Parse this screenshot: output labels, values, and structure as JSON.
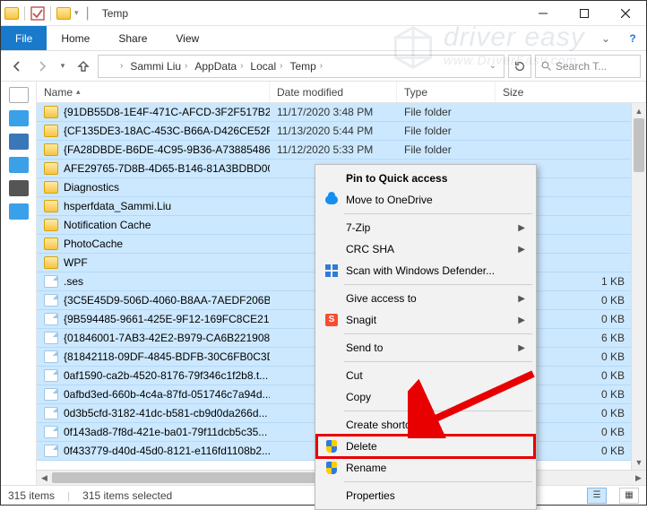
{
  "window": {
    "title": "Temp"
  },
  "tabs": {
    "file": "File",
    "home": "Home",
    "share": "Share",
    "view": "View"
  },
  "breadcrumbs": [
    "Sammi Liu",
    "AppData",
    "Local",
    "Temp"
  ],
  "search": {
    "placeholder": "Search T..."
  },
  "columns": {
    "name": "Name",
    "date": "Date modified",
    "type": "Type",
    "size": "Size"
  },
  "files": [
    {
      "ico": "folder",
      "name": "{91DB55D8-1E4F-471C-AFCD-3F2F517B2...",
      "date": "11/17/2020 3:48 PM",
      "type": "File folder",
      "size": ""
    },
    {
      "ico": "folder",
      "name": "{CF135DE3-18AC-453C-B66A-D426CE52F...",
      "date": "11/13/2020 5:44 PM",
      "type": "File folder",
      "size": ""
    },
    {
      "ico": "folder",
      "name": "{FA28DBDE-B6DE-4C95-9B36-A73885486...",
      "date": "11/12/2020 5:33 PM",
      "type": "File folder",
      "size": ""
    },
    {
      "ico": "folder",
      "name": "AFE29765-7D8B-4D65-B146-81A3BDBD00...",
      "date": "",
      "type": "",
      "size": ""
    },
    {
      "ico": "folder",
      "name": "Diagnostics",
      "date": "",
      "type": "",
      "size": ""
    },
    {
      "ico": "folder",
      "name": "hsperfdata_Sammi.Liu",
      "date": "",
      "type": "",
      "size": ""
    },
    {
      "ico": "folder",
      "name": "Notification Cache",
      "date": "",
      "type": "",
      "size": ""
    },
    {
      "ico": "folder",
      "name": "PhotoCache",
      "date": "",
      "type": "",
      "size": ""
    },
    {
      "ico": "folder",
      "name": "WPF",
      "date": "",
      "type": "",
      "size": ""
    },
    {
      "ico": "file",
      "name": ".ses",
      "date": "",
      "type": "",
      "size": "1 KB"
    },
    {
      "ico": "file",
      "name": "{3C5E45D9-506D-4060-B8AA-7AEDF206B...",
      "date": "",
      "type": "",
      "size": "0 KB"
    },
    {
      "ico": "file",
      "name": "{9B594485-9661-425E-9F12-169FC8CE21E...",
      "date": "",
      "type": "",
      "size": "0 KB"
    },
    {
      "ico": "file",
      "name": "{01846001-7AB3-42E2-B979-CA6B221908...",
      "date": "",
      "type": "",
      "size": "6 KB"
    },
    {
      "ico": "file",
      "name": "{81842118-09DF-4845-BDFB-30C6FB0C3D...",
      "date": "",
      "type": "",
      "size": "0 KB"
    },
    {
      "ico": "file",
      "name": "0af1590-ca2b-4520-8176-79f346c1f2b8.t...",
      "date": "",
      "type": "",
      "size": "0 KB"
    },
    {
      "ico": "file",
      "name": "0afbd3ed-660b-4c4a-87fd-051746c7a94d...",
      "date": "",
      "type": "",
      "size": "0 KB"
    },
    {
      "ico": "file",
      "name": "0d3b5cfd-3182-41dc-b581-cb9d0da266d...",
      "date": "",
      "type": "",
      "size": "0 KB"
    },
    {
      "ico": "file",
      "name": "0f143ad8-7f8d-421e-ba01-79f11dcb5c35...",
      "date": "",
      "type": "",
      "size": "0 KB"
    },
    {
      "ico": "file",
      "name": "0f433779-d40d-45d0-8121-e116fd1108b2...",
      "date": "",
      "type": "",
      "size": "0 KB"
    }
  ],
  "context_menu": {
    "pin": "Pin to Quick access",
    "onedrive": "Move to OneDrive",
    "sevenzip": "7-Zip",
    "crc": "CRC SHA",
    "defender": "Scan with Windows Defender...",
    "giveaccess": "Give access to",
    "snagit": "Snagit",
    "sendto": "Send to",
    "cut": "Cut",
    "copy": "Copy",
    "shortcut": "Create shortcut",
    "delete": "Delete",
    "rename": "Rename",
    "properties": "Properties"
  },
  "status": {
    "items": "315 items",
    "selected": "315 items selected"
  },
  "watermark": {
    "brand": "driver easy",
    "url": "www.DriverEasy.com"
  }
}
